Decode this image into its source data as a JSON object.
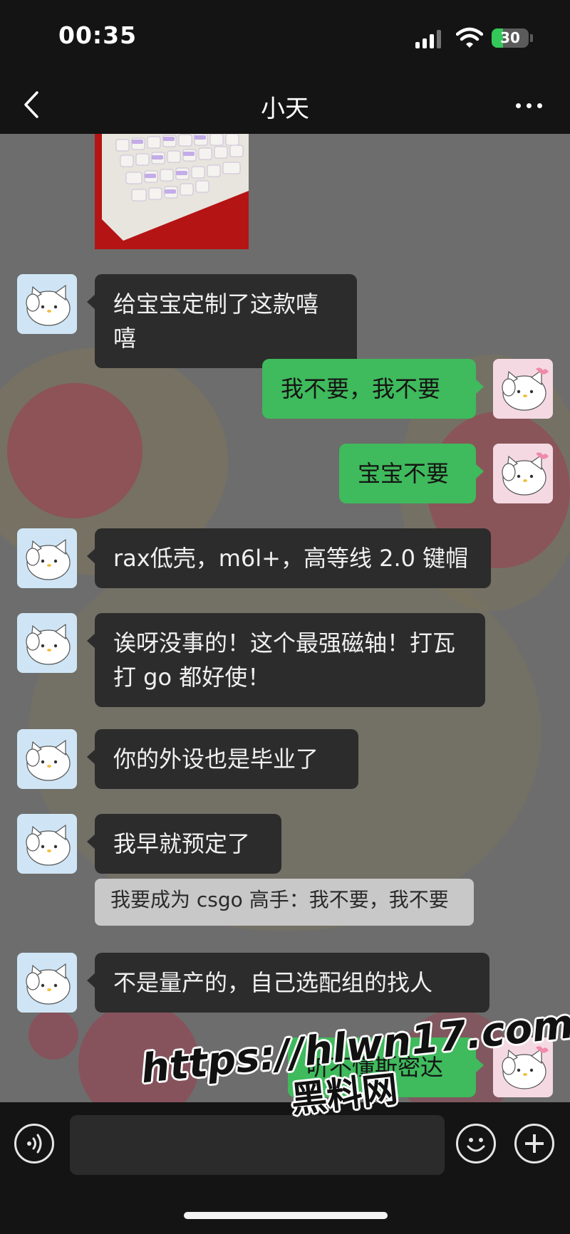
{
  "status_bar": {
    "time": "00:35",
    "battery": "30",
    "battery_level": 0.3
  },
  "header": {
    "title": "小天"
  },
  "messages": [
    {
      "side": "in",
      "text": "给宝宝定制了这款嘻嘻"
    },
    {
      "side": "out",
      "text": "我不要，我不要"
    },
    {
      "side": "out",
      "text": "宝宝不要"
    },
    {
      "side": "in",
      "text": "rax低壳，m6l+，高等线 2.0 键帽"
    },
    {
      "side": "in",
      "text": "诶呀没事的！这个最强磁轴！打瓦打 go 都好使！"
    },
    {
      "side": "in",
      "text": "你的外设也是毕业了"
    },
    {
      "side": "in",
      "text": "我早就预定了"
    },
    {
      "side": "in",
      "text": "不是量产的，自己选配组的找人"
    },
    {
      "side": "out",
      "text": "听不懂斯密达"
    }
  ],
  "quote": {
    "text": "我要成为 csgo 高手：我不要，我不要"
  },
  "watermark": {
    "line1": "https://hlwn17.com",
    "line2": "黑料网"
  },
  "colors": {
    "incoming_bubble": "#2c2c2c",
    "outgoing_bubble": "#3fba5c",
    "chat_bg": "#6d6d6d",
    "bar_bg": "#141414"
  }
}
